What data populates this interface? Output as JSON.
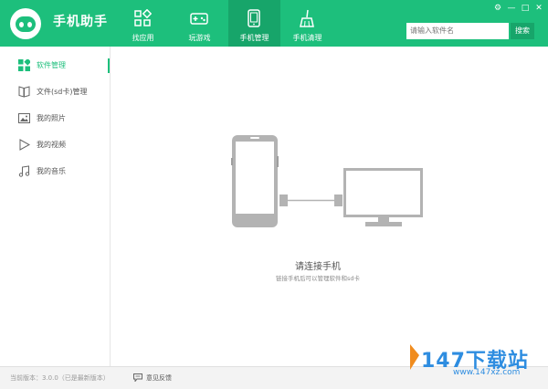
{
  "app": {
    "title": "手机助手"
  },
  "nav": [
    {
      "label": "找应用",
      "icon": "apps-grid-icon"
    },
    {
      "label": "玩游戏",
      "icon": "gamepad-icon"
    },
    {
      "label": "手机管理",
      "icon": "phone-icon",
      "active": true
    },
    {
      "label": "手机清理",
      "icon": "broom-icon"
    }
  ],
  "window_controls": {
    "settings": "⚙",
    "minimize": "—",
    "maximize": "□",
    "close": "✕"
  },
  "search": {
    "placeholder": "请输入软件名",
    "button": "搜索"
  },
  "sidebar": {
    "items": [
      {
        "label": "软件管理",
        "icon": "grid-icon",
        "active": true
      },
      {
        "label": "文件(sd卡)管理",
        "icon": "book-icon"
      },
      {
        "label": "我的照片",
        "icon": "image-icon"
      },
      {
        "label": "我的视频",
        "icon": "play-icon"
      },
      {
        "label": "我的音乐",
        "icon": "music-note-icon"
      }
    ]
  },
  "main": {
    "title": "请连接手机",
    "subtitle": "链接手机后可以管理软件和sd卡"
  },
  "status": {
    "version": "当前版本：3.0.0（已是最新版本）",
    "feedback": "意见反馈"
  },
  "watermark": {
    "text": "147下载站",
    "url": "www.147xz.com"
  },
  "colors": {
    "accent": "#1dbf7c",
    "accent_dark": "#17a56a",
    "watermark": "#2e8de0"
  }
}
